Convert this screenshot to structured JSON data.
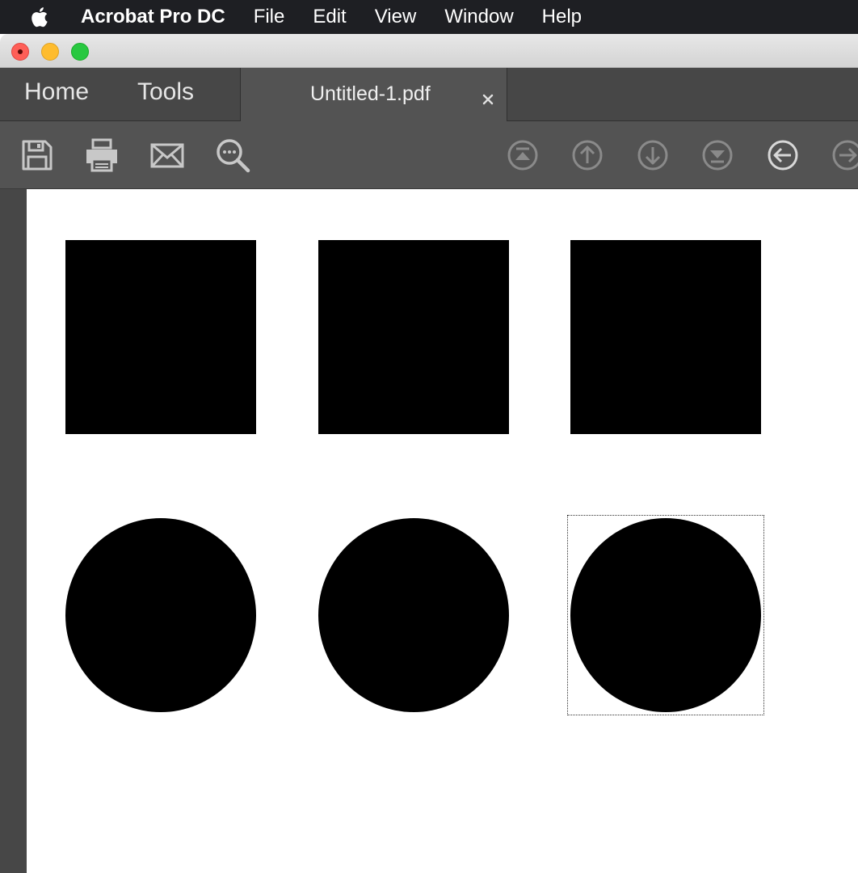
{
  "menubar": {
    "app_name": "Acrobat Pro DC",
    "items": [
      "File",
      "Edit",
      "View",
      "Window",
      "Help"
    ]
  },
  "tabs": {
    "home": "Home",
    "tools": "Tools",
    "document": "Untitled-1.pdf",
    "close_glyph": "×"
  },
  "toolbar": {
    "left_icons": [
      "save-icon",
      "print-icon",
      "email-icon",
      "find-icon"
    ],
    "nav_icons": [
      "first-page-icon",
      "previous-page-icon",
      "next-page-icon",
      "last-page-icon",
      "previous-view-icon",
      "next-view-icon"
    ],
    "active_nav": "previous-view-icon"
  },
  "colors": {
    "menubar": "#1e1f23",
    "tabbar": "#474747",
    "toolbar": "#535353",
    "icon_dim": "#8a8a8a",
    "icon_light": "#d8d8d8",
    "shape_fill": "#000000"
  },
  "document": {
    "shapes": [
      {
        "type": "square",
        "row": 1,
        "column": 1
      },
      {
        "type": "square",
        "row": 1,
        "column": 2
      },
      {
        "type": "square",
        "row": 1,
        "column": 3
      },
      {
        "type": "circle",
        "row": 2,
        "column": 1
      },
      {
        "type": "circle",
        "row": 2,
        "column": 2
      },
      {
        "type": "circle",
        "row": 2,
        "column": 3,
        "selected": true
      }
    ]
  }
}
